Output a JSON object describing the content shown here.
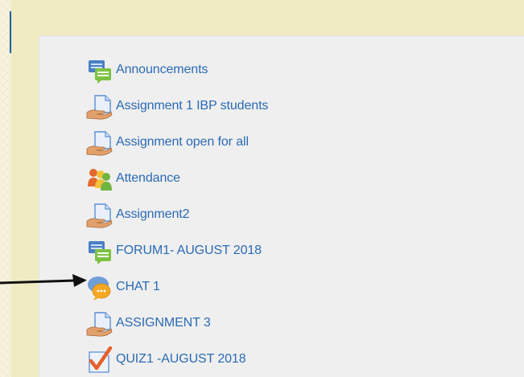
{
  "activities": [
    {
      "label": "Announcements",
      "icon": "forum-icon"
    },
    {
      "label": "Assignment 1 IBP students",
      "icon": "assignment-icon"
    },
    {
      "label": "Assignment open for all",
      "icon": "assignment-icon"
    },
    {
      "label": "Attendance",
      "icon": "attendance-icon"
    },
    {
      "label": "Assignment2",
      "icon": "assignment-icon"
    },
    {
      "label": "FORUM1- AUGUST 2018",
      "icon": "forum-icon"
    },
    {
      "label": "CHAT 1",
      "icon": "chat-icon"
    },
    {
      "label": "ASSIGNMENT 3",
      "icon": "assignment-icon"
    },
    {
      "label": "QUIZ1 -AUGUST 2018",
      "icon": "quiz-icon"
    }
  ],
  "colors": {
    "link": "#2a6bb4",
    "page_background": "#f6f2dc",
    "panel_background": "#efefef",
    "band": "#f1ebc3"
  }
}
